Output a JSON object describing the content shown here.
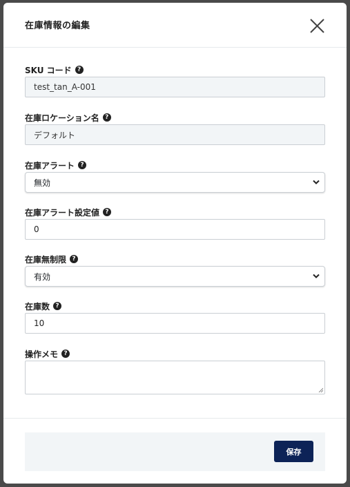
{
  "modal": {
    "title": "在庫情報の編集",
    "fields": [
      {
        "label": "SKU コード",
        "value": "test_tan_A-001",
        "kind": "readonly"
      },
      {
        "label": "在庫ロケーション名",
        "value": "デフォルト",
        "kind": "readonly"
      },
      {
        "label": "在庫アラート",
        "value": "無効",
        "kind": "select"
      },
      {
        "label": "在庫アラート設定値",
        "value": "0",
        "kind": "input"
      },
      {
        "label": "在庫無制限",
        "value": "有効",
        "kind": "select"
      },
      {
        "label": "在庫数",
        "value": "10",
        "kind": "input"
      },
      {
        "label": "操作メモ",
        "value": "",
        "kind": "textarea"
      }
    ],
    "save_label": "保存"
  },
  "icons": {
    "close": "close-icon",
    "help": "question-circle-icon",
    "select": "chevron-down-icon"
  },
  "colors": {
    "primary": "#0d2357",
    "readonly_bg": "#f2f5f7"
  }
}
